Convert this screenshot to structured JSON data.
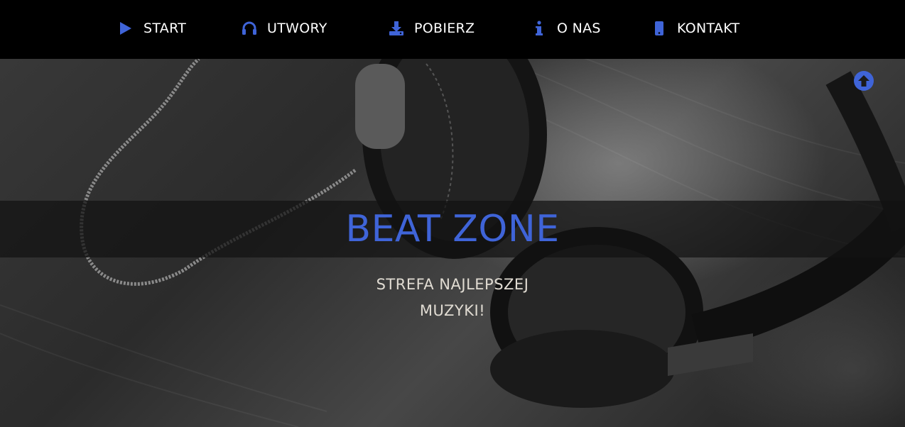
{
  "nav": {
    "items": [
      {
        "label": "START",
        "icon": "play-icon"
      },
      {
        "label": "UTWORY",
        "icon": "headphones-icon"
      },
      {
        "label": "POBIERZ",
        "icon": "download-icon"
      },
      {
        "label": "O NAS",
        "icon": "info-icon"
      },
      {
        "label": "KONTAKT",
        "icon": "phone-icon"
      }
    ]
  },
  "hero": {
    "title": "BEAT ZONE",
    "subtitle_line1": "STREFA NAJLEPSZEJ",
    "subtitle_line2": "MUZYKI!",
    "background": "headphones-photo"
  },
  "scroll_top": {
    "icon": "arrow-up-circle-icon"
  },
  "colors": {
    "accent": "#3f64d8",
    "nav_background": "#000000",
    "nav_text": "#ffffff",
    "subtitle": "#e0dbd2"
  }
}
